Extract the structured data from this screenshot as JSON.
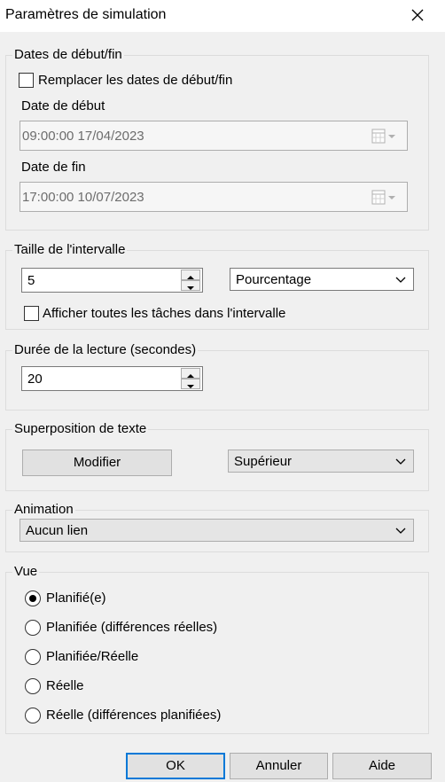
{
  "window": {
    "title": "Paramètres de simulation"
  },
  "dates": {
    "legend": "Dates de début/fin",
    "override_label": "Remplacer les dates de début/fin",
    "override_checked": false,
    "start_label": "Date de début",
    "start_value": "09:00:00 17/04/2023",
    "end_label": "Date de fin",
    "end_value": "17:00:00 10/07/2023"
  },
  "interval": {
    "legend": "Taille de l'intervalle",
    "size_value": "5",
    "unit_value": "Pourcentage",
    "show_all_label": "Afficher toutes les tâches dans l'intervalle",
    "show_all_checked": false
  },
  "playback": {
    "legend": "Durée de la lecture (secondes)",
    "value": "20"
  },
  "overlay": {
    "legend": "Superposition de texte",
    "edit_label": "Modifier",
    "position_value": "Supérieur"
  },
  "animation": {
    "legend": "Animation",
    "value": "Aucun lien"
  },
  "view": {
    "legend": "Vue",
    "options": [
      {
        "label": "Planifié(e)",
        "selected": true
      },
      {
        "label": "Planifiée (différences réelles)",
        "selected": false
      },
      {
        "label": "Planifiée/Réelle",
        "selected": false
      },
      {
        "label": "Réelle",
        "selected": false
      },
      {
        "label": "Réelle (différences planifiées)",
        "selected": false
      }
    ]
  },
  "footer": {
    "ok_label": "OK",
    "cancel_label": "Annuler",
    "help_label": "Aide"
  },
  "colors": {
    "accent": "#0078d7",
    "background": "#f0f0f0"
  },
  "icons": {
    "close": "close-icon",
    "calendar": "calendar-icon",
    "dropdown": "chevron-down-icon"
  }
}
